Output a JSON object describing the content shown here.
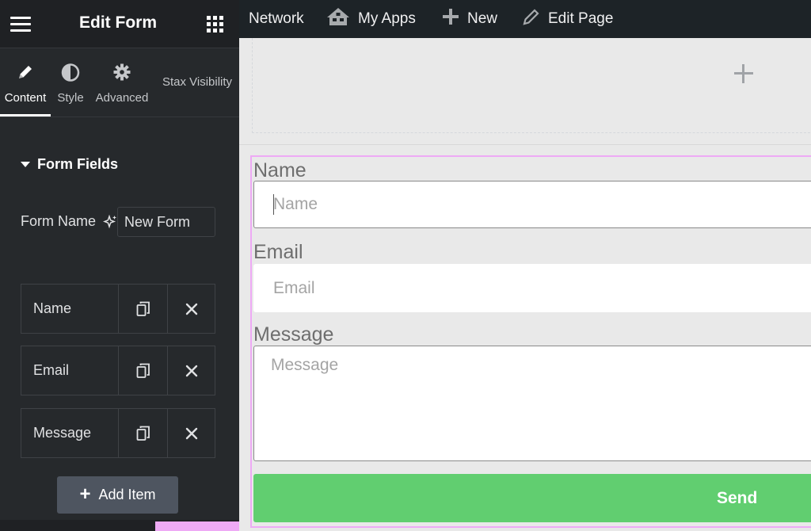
{
  "panel": {
    "title": "Edit Form",
    "tabs": [
      {
        "label": "Content",
        "icon": "pencil-icon"
      },
      {
        "label": "Style",
        "icon": "half-circle-icon"
      },
      {
        "label": "Advanced",
        "icon": "gear-icon"
      },
      {
        "label": "Stax Visibility"
      }
    ],
    "section_title": "Form Fields",
    "form_name_label": "Form Name",
    "form_name_value": "New Form",
    "items": [
      {
        "title": "Name"
      },
      {
        "title": "Email"
      },
      {
        "title": "Message"
      }
    ],
    "add_item_label": "Add Item"
  },
  "adminbar": {
    "network": "Network",
    "my_apps": "My Apps",
    "new": "New",
    "edit_page": "Edit Page"
  },
  "form": {
    "name_label": "Name",
    "name_placeholder": "Name",
    "email_label": "Email",
    "email_placeholder": "Email",
    "message_label": "Message",
    "message_placeholder": "Message",
    "submit_label": "Send"
  },
  "colors": {
    "accent_pink": "#eeaaf5",
    "send_green": "#61ce70",
    "panel_bg": "#26292c",
    "adminbar_bg": "#1d2327"
  }
}
